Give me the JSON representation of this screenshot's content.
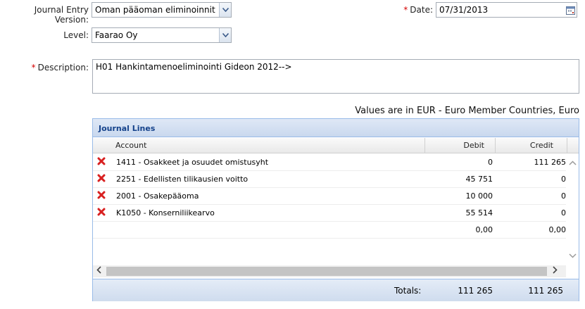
{
  "form": {
    "journal_version_label": "Journal Entry Version:",
    "journal_version_value": "Oman pääoman eliminoinnit",
    "level_label": "Level:",
    "level_value": "Faarao Oy",
    "date_required": "*",
    "date_label": "Date:",
    "date_value": "07/31/2013",
    "description_required": "*",
    "description_label": "Description:",
    "description_value": "H01 Hankintamenoeliminointi Gideon 2012-->"
  },
  "currency_note": "Values are in EUR - Euro Member Countries, Euro",
  "journal_lines": {
    "title": "Journal Lines",
    "columns": {
      "account": "Account",
      "debit": "Debit",
      "credit": "Credit"
    },
    "rows": [
      {
        "account": "1411 - Osakkeet ja osuudet omistusyht",
        "debit": "0",
        "credit": "111 265"
      },
      {
        "account": "2251 - Edellisten tilikausien voitto",
        "debit": "45 751",
        "credit": "0"
      },
      {
        "account": "2001 - Osakepääoma",
        "debit": "10 000",
        "credit": "0"
      },
      {
        "account": "K1050 - Konserniliikearvo",
        "debit": "55 514",
        "credit": "0"
      }
    ],
    "new_row": {
      "debit": "0,00",
      "credit": "0,00"
    },
    "totals_label": "Totals:",
    "total_debit": "111 265",
    "total_credit": "111 265"
  },
  "icons": {
    "dropdown": "chevron-down-icon",
    "calendar": "calendar-icon",
    "delete": "delete-x-icon",
    "scroll_up": "chevron-up-icon",
    "scroll_down": "chevron-down-icon",
    "scroll_left": "chevron-left-icon",
    "scroll_right": "chevron-right-icon"
  },
  "colors": {
    "delete_icon": "#d82020",
    "panel_header": "#15428b",
    "required": "#d40000"
  }
}
